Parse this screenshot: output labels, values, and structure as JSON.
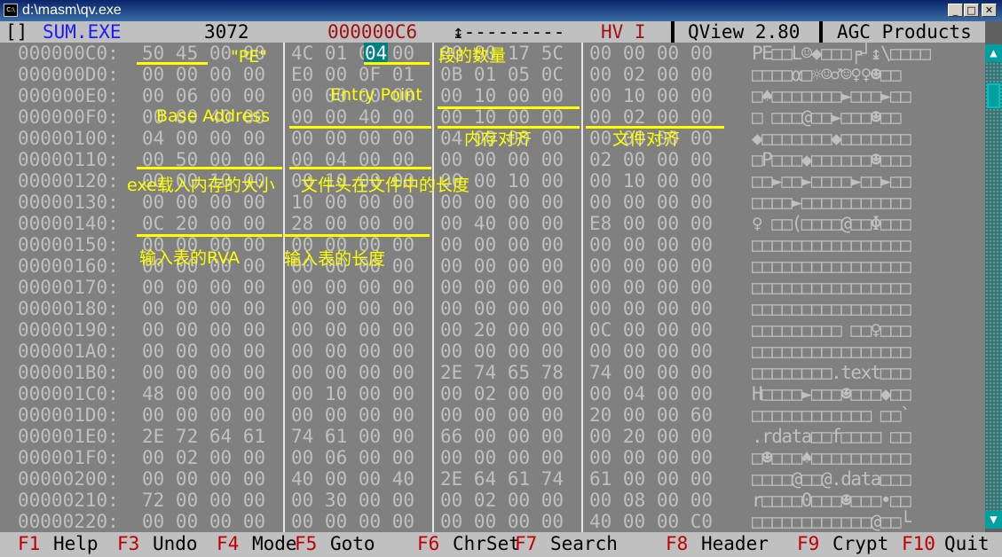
{
  "window": {
    "title": "d:\\masm\\qv.exe",
    "icon_label": "C:\\",
    "buttons": {
      "minimize": "_",
      "maximize": "□",
      "close": "✕"
    }
  },
  "status": {
    "bracket": "[]",
    "file": "SUM.EXE",
    "size": "3072",
    "offset": "000000C6",
    "cursor": "↨---------",
    "mode": "HV I",
    "app": "QView 2.80",
    "vendor": "AGC Products"
  },
  "dump_rows": [
    {
      "addr": "000000C0:",
      "g": [
        "50 45 00 00",
        "4C 01 04 00",
        "00 00 17 5C",
        "00 00 00 00"
      ],
      "ascii": "PE□□L☺◆□□□╒┘↨\\□□□□"
    },
    {
      "addr": "000000D0:",
      "g": [
        "00 00 00 00",
        "E0 00 0F 01",
        "0B 01 05 0C",
        "00 02 00 00"
      ],
      "ascii": "□□□□α□☼☺♂☺♀♀☻□□"
    },
    {
      "addr": "000000E0:",
      "g": [
        "00 06 00 00",
        "00 00 00 00",
        "00 10 00 00",
        "00 10 00 00"
      ],
      "ascii": "□♠□□□□□□□►□□□►□□"
    },
    {
      "addr": "000000F0:",
      "g": [
        "00 00 40 00",
        "00 00 40 00",
        "00 10 00 00",
        "00 02 00 00"
      ],
      "ascii": "□ □□□@□□►□□□☻□□"
    },
    {
      "addr": "00000100:",
      "g": [
        "04 00 00 00",
        "00 00 00 00",
        "04 00 00 00",
        "00 00 00 00"
      ],
      "ascii": "◆□□□□□□□◆□□□□□□□"
    },
    {
      "addr": "00000110:",
      "g": [
        "00 50 00 00",
        "00 04 00 00",
        "00 00 00 00",
        "02 00 00 00"
      ],
      "ascii": "□P□□□◆□□□□□□☻□□□"
    },
    {
      "addr": "00000120:",
      "g": [
        "00 00 10 00",
        "00 10 00 00",
        "00 00 10 00",
        "00 10 00 00"
      ],
      "ascii": "□□►□□►□□□□►□□►□□"
    },
    {
      "addr": "00000130:",
      "g": [
        "00 00 00 00",
        "10 00 00 00",
        "00 00 00 00",
        "00 00 00 00"
      ],
      "ascii": "□□□□►□□□□□□□□□□□"
    },
    {
      "addr": "00000140:",
      "g": [
        "0C 20 00 00",
        "28 00 00 00",
        "00 40 00 00",
        "E8 00 00 00"
      ],
      "ascii": "♀ □□(□□□□@□□Φ□□□"
    },
    {
      "addr": "00000150:",
      "g": [
        "00 00 00 00",
        "00 00 00 00",
        "00 00 00 00",
        "00 00 00 00"
      ],
      "ascii": "□□□□□□□□□□□□□□□□"
    },
    {
      "addr": "00000160:",
      "g": [
        "00 00 00 00",
        "00 00 00 00",
        "00 00 00 00",
        "00 00 00 00"
      ],
      "ascii": "□□□□□□□□□□□□□□□□"
    },
    {
      "addr": "00000170:",
      "g": [
        "00 00 00 00",
        "00 00 00 00",
        "00 00 00 00",
        "00 00 00 00"
      ],
      "ascii": "□□□□□□□□□□□□□□□□"
    },
    {
      "addr": "00000180:",
      "g": [
        "00 00 00 00",
        "00 00 00 00",
        "00 00 00 00",
        "00 00 00 00"
      ],
      "ascii": "□□□□□□□□□□□□□□□□"
    },
    {
      "addr": "00000190:",
      "g": [
        "00 00 00 00",
        "00 00 00 00",
        "00 20 00 00",
        "0C 00 00 00"
      ],
      "ascii": "□□□□□□□□□ □□♀□□□"
    },
    {
      "addr": "000001A0:",
      "g": [
        "00 00 00 00",
        "00 00 00 00",
        "00 00 00 00",
        "00 00 00 00"
      ],
      "ascii": "□□□□□□□□□□□□□□□□"
    },
    {
      "addr": "000001B0:",
      "g": [
        "00 00 00 00",
        "00 00 00 00",
        "2E 74 65 78",
        "74 00 00 00"
      ],
      "ascii": "□□□□□□□□.text□□□"
    },
    {
      "addr": "000001C0:",
      "g": [
        "48 00 00 00",
        "00 10 00 00",
        "00 02 00 00",
        "00 04 00 00"
      ],
      "ascii": "H□□□□►□□□☻□□□◆□□"
    },
    {
      "addr": "000001D0:",
      "g": [
        "00 00 00 00",
        "00 00 00 00",
        "00 00 00 00",
        "20 00 00 60"
      ],
      "ascii": "□□□□□□□□□□□□ □□`"
    },
    {
      "addr": "000001E0:",
      "g": [
        "2E 72 64 61",
        "74 61 00 00",
        "66 00 00 00",
        "00 20 00 00"
      ],
      "ascii": ".rdata□□f□□□□ □□"
    },
    {
      "addr": "000001F0:",
      "g": [
        "00 02 00 00",
        "00 06 00 00",
        "00 00 00 00",
        "00 00 00 00"
      ],
      "ascii": "□☻□□□♠□□□□□□□□□□"
    },
    {
      "addr": "00000200:",
      "g": [
        "00 00 00 00",
        "40 00 00 40",
        "2E 64 61 74",
        "61 00 00 00"
      ],
      "ascii": "□□□□@□□@.data□□□"
    },
    {
      "addr": "00000210:",
      "g": [
        "72 00 00 00",
        "00 30 00 00",
        "00 02 00 00",
        "00 08 00 00"
      ],
      "ascii": "r□□□□0□□□☻□□□•□□"
    },
    {
      "addr": "00000220:",
      "g": [
        "00 00 00 00",
        "00 00 00 00",
        "00 00 00 00",
        "40 00 00 C0"
      ],
      "ascii": "□□□□□□□□□□□□@□□└"
    }
  ],
  "selected_byte": "04",
  "annotations": {
    "pe": "\"PE\"",
    "num_sections": "段的数量",
    "entry_point": "Entry Point",
    "base_address": "Base Address",
    "section_align": "内存对齐",
    "file_align": "文件对齐",
    "image_size": "exe载入内存的大小",
    "header_size": "文件头在文件中的长度",
    "import_rva": "输入表的RVA",
    "import_size": "输入表的长度"
  },
  "fkeys": [
    {
      "key": "F1",
      "label": "Help"
    },
    {
      "key": "F3",
      "label": "Undo"
    },
    {
      "key": "F4",
      "label": "Mode"
    },
    {
      "key": "F5",
      "label": "Goto"
    },
    {
      "key": "F6",
      "label": "ChrSet"
    },
    {
      "key": "F7",
      "label": "Search"
    },
    {
      "key": "F8",
      "label": "Header"
    },
    {
      "key": "F9",
      "label": "Crypt"
    },
    {
      "key": "F10",
      "label": "Quit"
    }
  ],
  "colors": {
    "annotation": "#ffff00",
    "highlight": "#008080",
    "fkey": "#c00000"
  }
}
